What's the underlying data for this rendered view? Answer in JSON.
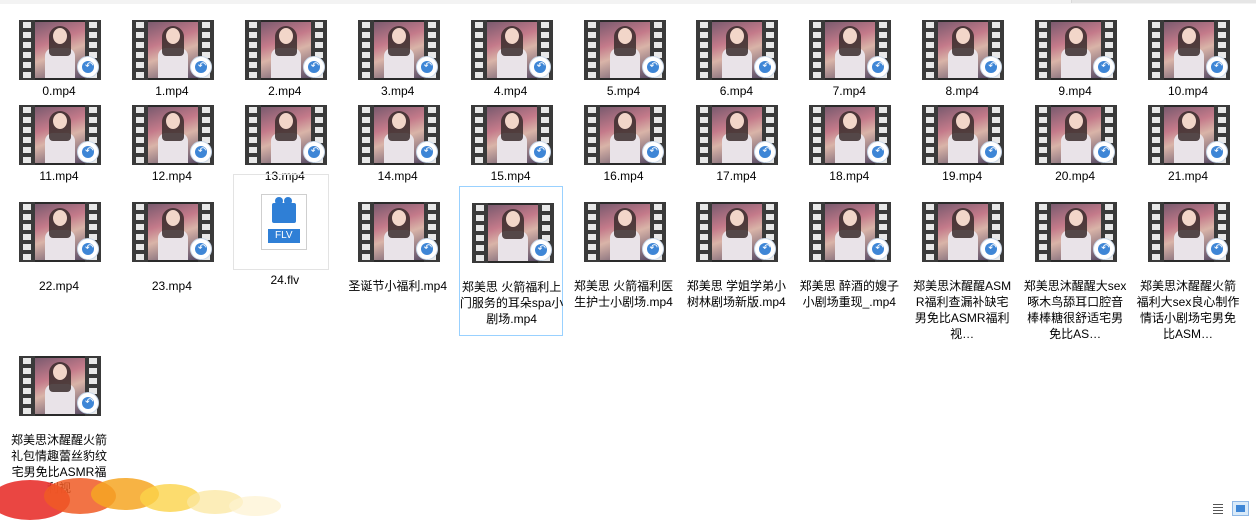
{
  "files": [
    {
      "name": "0.mp4",
      "type": "video"
    },
    {
      "name": "1.mp4",
      "type": "video"
    },
    {
      "name": "2.mp4",
      "type": "video"
    },
    {
      "name": "3.mp4",
      "type": "video"
    },
    {
      "name": "4.mp4",
      "type": "video"
    },
    {
      "name": "5.mp4",
      "type": "video"
    },
    {
      "name": "6.mp4",
      "type": "video"
    },
    {
      "name": "7.mp4",
      "type": "video"
    },
    {
      "name": "8.mp4",
      "type": "video"
    },
    {
      "name": "9.mp4",
      "type": "video"
    },
    {
      "name": "10.mp4",
      "type": "video"
    },
    {
      "name": "11.mp4",
      "type": "video"
    },
    {
      "name": "12.mp4",
      "type": "video"
    },
    {
      "name": "13.mp4",
      "type": "video"
    },
    {
      "name": "14.mp4",
      "type": "video"
    },
    {
      "name": "15.mp4",
      "type": "video"
    },
    {
      "name": "16.mp4",
      "type": "video"
    },
    {
      "name": "17.mp4",
      "type": "video"
    },
    {
      "name": "18.mp4",
      "type": "video"
    },
    {
      "name": "19.mp4",
      "type": "video"
    },
    {
      "name": "20.mp4",
      "type": "video"
    },
    {
      "name": "21.mp4",
      "type": "video"
    },
    {
      "name": "22.mp4",
      "type": "video"
    },
    {
      "name": "23.mp4",
      "type": "video"
    },
    {
      "name": "24.flv",
      "type": "flv",
      "icon_text": "FLV"
    },
    {
      "name": "圣诞节小福利.mp4",
      "type": "video"
    },
    {
      "name": "郑美思 火箭福利上门服务的耳朵spa小剧场.mp4",
      "type": "video",
      "selected": true
    },
    {
      "name": "郑美思 火箭福利医生护士小剧场.mp4",
      "type": "video"
    },
    {
      "name": "郑美思 学姐学弟小树林剧场新版.mp4",
      "type": "video"
    },
    {
      "name": "郑美思 醉酒的嫂子小剧场重现_.mp4",
      "type": "video"
    },
    {
      "name": "郑美思沐醒醒ASMR福利查漏补缺宅男免比ASMR福利视…",
      "type": "video"
    },
    {
      "name": "郑美思沐醒醒大sex啄木鸟舔耳口腔音棒棒糖很舒适宅男免比AS…",
      "type": "video"
    },
    {
      "name": "郑美思沐醒醒火箭福利大sex良心制作情话小剧场宅男免比ASM…",
      "type": "video"
    },
    {
      "name": "郑美思沐醒醒火箭礼包情趣蕾丝豹纹宅男免比ASMR福利视",
      "type": "video"
    }
  ],
  "view_controls": {
    "details_icon": "details-view-icon",
    "large_icon": "large-icons-view-icon",
    "active": "large-icons"
  },
  "colors": {
    "selection_border": "#99d1ff",
    "badge_blue": "#3e86d6",
    "flv_blue": "#2f7fd6"
  }
}
